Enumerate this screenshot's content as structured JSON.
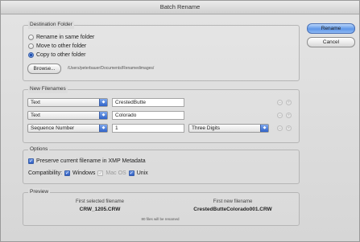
{
  "window": {
    "title": "Batch Rename"
  },
  "actions": {
    "rename": "Rename",
    "cancel": "Cancel"
  },
  "destination": {
    "label": "Destination Folder",
    "options": [
      "Rename in same folder",
      "Move to other folder",
      "Copy to other folder"
    ],
    "selected": "Copy to other folder",
    "browse": "Browse...",
    "path": "/Users/peterbauer/Documents/Renamedimages/"
  },
  "filenames": {
    "label": "New Filenames",
    "rows": [
      {
        "type": "Text",
        "value": "CrestedButte"
      },
      {
        "type": "Text",
        "value": "Colorado"
      },
      {
        "type": "Sequence Number",
        "value": "1",
        "digits": "Three Digits"
      }
    ],
    "minus_glyph": "–",
    "plus_glyph": "+"
  },
  "options": {
    "label": "Options",
    "preserve": "Preserve current filename in XMP Metadata",
    "compat_label": "Compatibility:",
    "windows": "Windows",
    "macos": "Mac OS",
    "unix": "Unix",
    "check_glyph": "✓"
  },
  "preview": {
    "label": "Preview",
    "first_selected_label": "First selected filename",
    "first_selected_value": "CRW_1205.CRW",
    "first_new_label": "First new filename",
    "first_new_value": "CrestedButteColorado001.CRW",
    "note": "80 files will be renamed"
  },
  "icons": {
    "dropdown": "dropdown-arrow-icon",
    "remove": "minus-icon",
    "add": "plus-icon",
    "check": "checkmark-icon"
  },
  "colors": {
    "accent": "#2f62c8",
    "primary_button": "#5f97e8"
  }
}
